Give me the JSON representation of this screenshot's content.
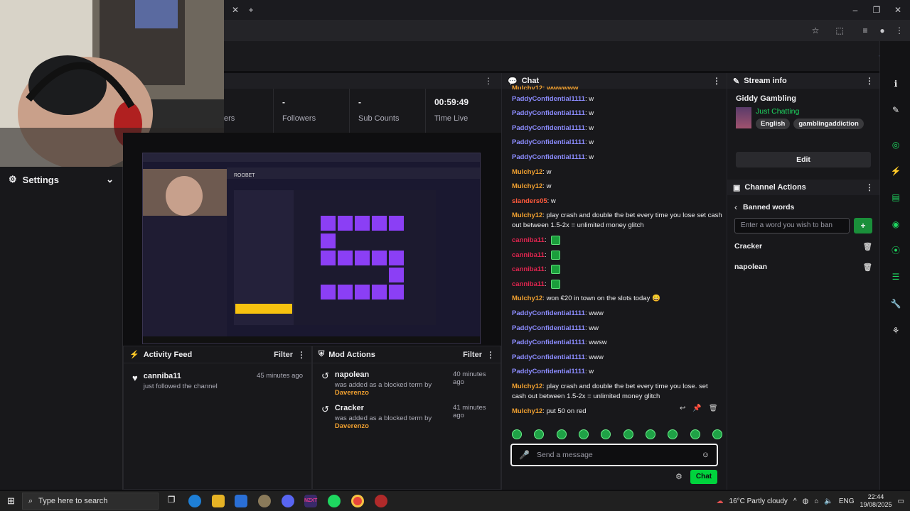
{
  "stats": [
    {
      "value": "-",
      "label": "Followers"
    },
    {
      "value": "-",
      "label": "Sub Counts"
    },
    {
      "value": "00:59:49",
      "label": "Time Live"
    }
  ],
  "stats_partial_label": "ers",
  "settings": {
    "label": "Settings"
  },
  "activity_feed": {
    "title": "Activity Feed",
    "filter": "Filter",
    "items": [
      {
        "name": "canniba11",
        "sub": "just followed the channel",
        "time": "45 minutes ago"
      }
    ]
  },
  "mod_actions": {
    "title": "Mod Actions",
    "filter": "Filter",
    "items": [
      {
        "name": "napolean",
        "sub": "was added as a blocked term by",
        "by": "Daverenzo",
        "time": "40 minutes ago"
      },
      {
        "name": "Cracker",
        "sub": "was added as a blocked term by",
        "by": "Daverenzo",
        "time": "41 minutes ago"
      }
    ]
  },
  "chat": {
    "title": "Chat",
    "top_partial": "Mulchy12: wwwwww",
    "messages": [
      {
        "user": "PaddyConfidential1111",
        "color": "#8c8cff",
        "text": ": w"
      },
      {
        "user": "PaddyConfidential1111",
        "color": "#8c8cff",
        "text": ": w"
      },
      {
        "user": "PaddyConfidential1111",
        "color": "#8c8cff",
        "text": ": w"
      },
      {
        "user": "PaddyConfidential1111",
        "color": "#8c8cff",
        "text": ": w"
      },
      {
        "user": "PaddyConfidential1111",
        "color": "#8c8cff",
        "text": ": w"
      },
      {
        "user": "Mulchy12",
        "color": "#f0a030",
        "text": ": w"
      },
      {
        "user": "Mulchy12",
        "color": "#f0a030",
        "text": ": w"
      },
      {
        "user": "slanders05",
        "color": "#ff5a3c",
        "text": ": w"
      },
      {
        "user": "Mulchy12",
        "color": "#f0a030",
        "text": ": play crash and double the bet every time you lose set cash out between 1.5-2x = unlimited money glitch"
      },
      {
        "user": "canniba11",
        "color": "#e0254f",
        "text": ":",
        "emote": true
      },
      {
        "user": "canniba11",
        "color": "#e0254f",
        "text": ":",
        "emote": true
      },
      {
        "user": "canniba11",
        "color": "#e0254f",
        "text": ":",
        "emote": true
      },
      {
        "user": "canniba11",
        "color": "#e0254f",
        "text": ":",
        "emote": true
      },
      {
        "user": "Mulchy12",
        "color": "#f0a030",
        "text": ": won €20 in town on the slots today 😄"
      },
      {
        "user": "PaddyConfidential1111",
        "color": "#8c8cff",
        "text": ": www"
      },
      {
        "user": "PaddyConfidential1111",
        "color": "#8c8cff",
        "text": ": ww"
      },
      {
        "user": "PaddyConfidential1111",
        "color": "#8c8cff",
        "text": ": wwsw"
      },
      {
        "user": "PaddyConfidential1111",
        "color": "#8c8cff",
        "text": ": www"
      },
      {
        "user": "PaddyConfidential1111",
        "color": "#8c8cff",
        "text": ": w"
      },
      {
        "user": "Mulchy12",
        "color": "#f0a030",
        "text": ": play crash and double the bet every time you lose. set cash out between 1.5-2x = unlimited money glitch"
      },
      {
        "user": "Mulchy12",
        "color": "#f0a030",
        "text": ": put 50 on red"
      }
    ],
    "input_placeholder": "Send a message",
    "send_label": "Chat"
  },
  "stream_info": {
    "title": "Stream info",
    "channel": "Giddy Gambling",
    "category": "Just Chatting",
    "tags": [
      "English",
      "gamblingaddiction"
    ],
    "edit_label": "Edit"
  },
  "channel_actions": {
    "title": "Channel Actions",
    "banned_title": "Banned words",
    "placeholder": "Enter a word you wish to ban",
    "words": [
      "Cracker",
      "napolean"
    ]
  },
  "preview": {
    "site": "ROOBET"
  },
  "taskbar": {
    "search": "Type here to search",
    "weather": "16°C  Partly cloudy",
    "lang": "ENG",
    "time": "22:44",
    "date": "19/08/2025"
  },
  "colors": {
    "accent_green": "#00d33d",
    "chat_blue": "#8c8cff",
    "chat_orange": "#f0a030",
    "chat_red": "#e0254f",
    "purple": "#8b3ff5"
  }
}
